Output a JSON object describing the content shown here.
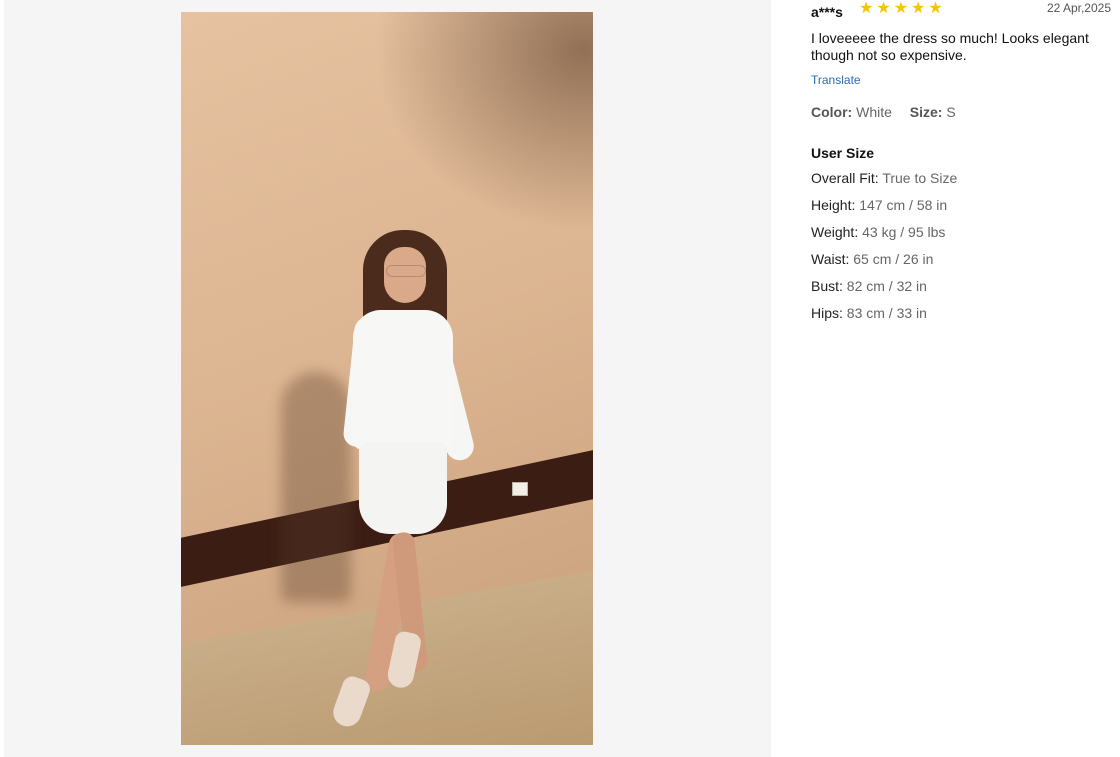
{
  "review": {
    "user": "a***s",
    "rating": 5,
    "star_glyph": "★",
    "date": "22 Apr,2025",
    "text": "I loveeeee the dress so much! Looks elegant though not so expensive.",
    "translate": "Translate",
    "color_label": "Color:",
    "color_value": "White",
    "size_label": "Size:",
    "size_value": "S"
  },
  "user_size": {
    "title": "User Size",
    "rows": [
      {
        "label": "Overall Fit:",
        "value": "True to Size"
      },
      {
        "label": "Height:",
        "value": "147 cm / 58 in"
      },
      {
        "label": "Weight:",
        "value": "43 kg / 95 lbs"
      },
      {
        "label": "Waist:",
        "value": "65 cm / 26 in"
      },
      {
        "label": "Bust:",
        "value": "82 cm / 32 in"
      },
      {
        "label": "Hips:",
        "value": "83 cm / 33 in"
      }
    ]
  },
  "colors": {
    "star": "#f6c500",
    "link": "#2b6cb0",
    "gallery_bg": "#f5f5f5"
  }
}
